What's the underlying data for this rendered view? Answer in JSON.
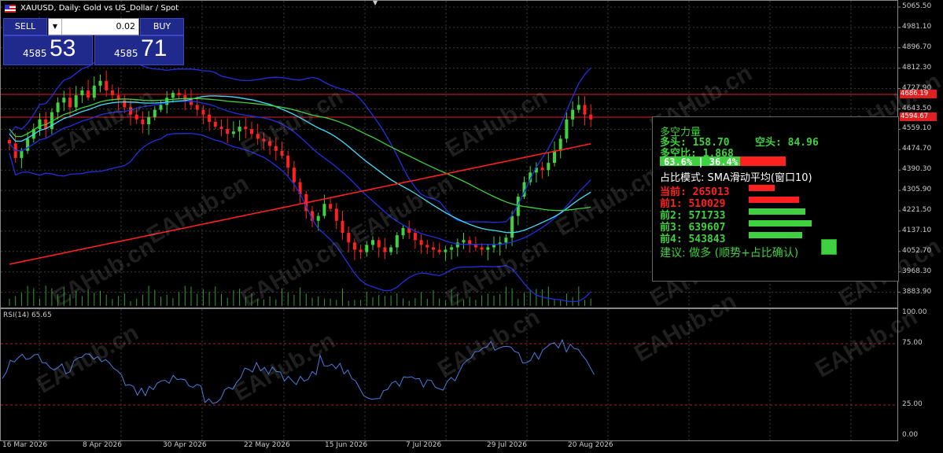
{
  "window": {
    "title": "XAUUSD, Daily:  Gold vs US_Dollar / Spot",
    "mini_marker": "▼"
  },
  "trade_panel": {
    "sell_label": "SELL",
    "buy_label": "BUY",
    "lot_value": "0.02",
    "lot_down_glyph": "▼",
    "lot_up_glyph": "▲",
    "sell_price_small": "4585",
    "sell_price_big": "53",
    "buy_price_small": "4585",
    "buy_price_big": "71"
  },
  "price_axis": {
    "labels": [
      "5065.50",
      "4981.10",
      "4896.70",
      "4812.30",
      "4727.90",
      "4643.50",
      "4559.10",
      "4474.70",
      "4390.30",
      "4305.90",
      "4221.50",
      "4137.10",
      "4052.70",
      "3968.30",
      "3883.90"
    ],
    "tag_upper": "4686.19",
    "tag_current": "4594.67"
  },
  "rsi_axis": {
    "labels": [
      "100.00",
      "75.00",
      "25.00",
      "0.00"
    ],
    "title": "RSI(14) 65.65"
  },
  "time_axis": {
    "labels": [
      "16 Mar 2026",
      "8 Apr 2026",
      "30 Apr 2026",
      "22 May 2026",
      "15 Jun 2026",
      "7 Jul 2026",
      "29 Jul 2026",
      "20 Aug 2026"
    ]
  },
  "info_panel": {
    "title": "多空力量",
    "bull_label": "多头: 158.70",
    "bear_label": "空头: 84.96",
    "ratio_label": "多空比: 1.868",
    "pct_text": "63.6%  |  36.4%",
    "mode_label": "占比模式: SMA滑动平均(窗口10)",
    "rows": [
      {
        "label": "当前: 265013",
        "value": 265013,
        "color": "#ff2020"
      },
      {
        "label": "前1: 510029",
        "value": 510029,
        "color": "#ff2020"
      },
      {
        "label": "前2: 571733",
        "value": 571733,
        "color": "#3fd13f"
      },
      {
        "label": "前3: 639607",
        "value": 639607,
        "color": "#3fd13f"
      },
      {
        "label": "前4: 543843",
        "value": 543843,
        "color": "#3fd13f"
      }
    ],
    "bull_pct": 63.6,
    "advice": "建议: 做多 (顺势+占比确认)"
  },
  "watermark": "EAHub.cn",
  "colors": {
    "bull": "#3fd13f",
    "bear": "#ff2020",
    "bollinger": "#2030e0",
    "ma_cyan": "#40e0ff",
    "ma_green": "#3fd13f",
    "ma_red": "#ff2020",
    "panel_bg": "#1f2a8c",
    "grid": "#3a3a3a"
  }
}
